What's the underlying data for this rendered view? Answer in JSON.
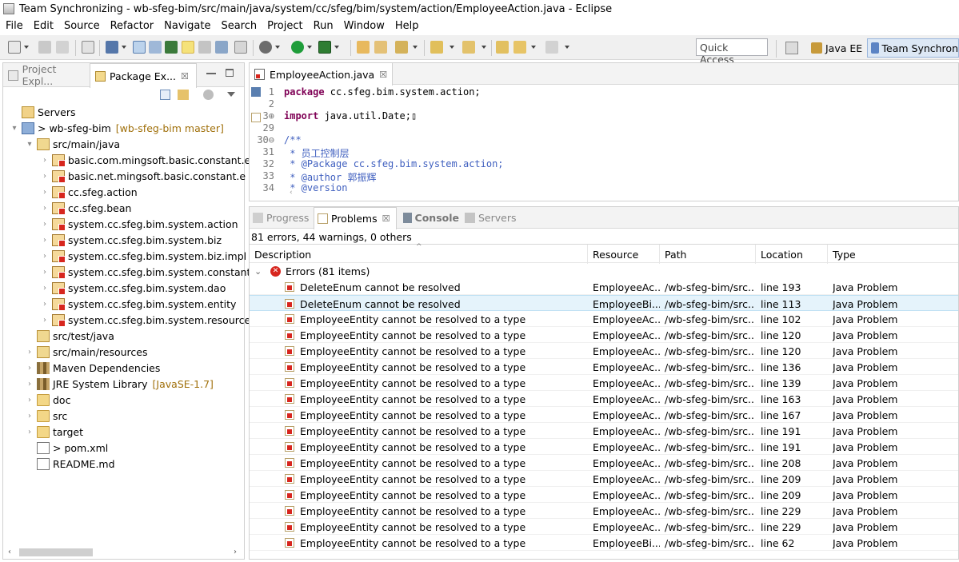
{
  "window": {
    "title": "Team Synchronizing - wb-sfeg-bim/src/main/java/system/cc/sfeg/bim/system/action/EmployeeAction.java - Eclipse"
  },
  "menu": [
    "File",
    "Edit",
    "Source",
    "Refactor",
    "Navigate",
    "Search",
    "Project",
    "Run",
    "Window",
    "Help"
  ],
  "toolbar": {
    "quick_access_placeholder": "Quick Access",
    "perspectives": [
      {
        "label": "Java EE",
        "icon": "java-ee-perspective-icon"
      },
      {
        "label": "Team Synchron",
        "icon": "team-sync-perspective-icon"
      }
    ]
  },
  "explorer": {
    "tabs": [
      {
        "label": "Project Expl...",
        "active": false
      },
      {
        "label": "Package Ex...",
        "active": true
      }
    ],
    "close_glyph": "☒",
    "items": [
      {
        "label": "Servers",
        "depth": 0,
        "expander": "",
        "icon": "servers"
      },
      {
        "label": "> wb-sfeg-bim",
        "decor": "[wb-sfeg-bim master]",
        "depth": 0,
        "expander": "▾",
        "icon": "proj"
      },
      {
        "label": "src/main/java",
        "depth": 1,
        "expander": "▾",
        "icon": "srcfolder"
      },
      {
        "label": "basic.com.mingsoft.basic.constant.e",
        "depth": 2,
        "expander": "›",
        "icon": "pkg"
      },
      {
        "label": "basic.net.mingsoft.basic.constant.e",
        "depth": 2,
        "expander": "›",
        "icon": "pkg"
      },
      {
        "label": "cc.sfeg.action",
        "depth": 2,
        "expander": "›",
        "icon": "pkg"
      },
      {
        "label": "cc.sfeg.bean",
        "depth": 2,
        "expander": "›",
        "icon": "pkg"
      },
      {
        "label": "system.cc.sfeg.bim.system.action",
        "depth": 2,
        "expander": "›",
        "icon": "pkg"
      },
      {
        "label": "system.cc.sfeg.bim.system.biz",
        "depth": 2,
        "expander": "›",
        "icon": "pkg"
      },
      {
        "label": "system.cc.sfeg.bim.system.biz.impl",
        "depth": 2,
        "expander": "›",
        "icon": "pkg"
      },
      {
        "label": "system.cc.sfeg.bim.system.constant.e",
        "depth": 2,
        "expander": "›",
        "icon": "pkg"
      },
      {
        "label": "system.cc.sfeg.bim.system.dao",
        "depth": 2,
        "expander": "›",
        "icon": "pkg"
      },
      {
        "label": "system.cc.sfeg.bim.system.entity",
        "depth": 2,
        "expander": "›",
        "icon": "pkg"
      },
      {
        "label": "system.cc.sfeg.bim.system.resources",
        "depth": 2,
        "expander": "›",
        "icon": "pkg"
      },
      {
        "label": "src/test/java",
        "depth": 1,
        "expander": "",
        "icon": "srcfolder"
      },
      {
        "label": "src/main/resources",
        "depth": 1,
        "expander": "›",
        "icon": "srcfolder"
      },
      {
        "label": "Maven Dependencies",
        "depth": 1,
        "expander": "›",
        "icon": "libr"
      },
      {
        "label": "JRE System Library",
        "decor": "[JavaSE-1.7]",
        "depth": 1,
        "expander": "›",
        "icon": "libr"
      },
      {
        "label": "doc",
        "depth": 1,
        "expander": "›",
        "icon": "folder"
      },
      {
        "label": "src",
        "depth": 1,
        "expander": "›",
        "icon": "folder"
      },
      {
        "label": "target",
        "depth": 1,
        "expander": "›",
        "icon": "folder"
      },
      {
        "label": "> pom.xml",
        "depth": 1,
        "expander": "",
        "icon": "file"
      },
      {
        "label": "README.md",
        "depth": 1,
        "expander": "",
        "icon": "file"
      }
    ]
  },
  "editor": {
    "tab_label": "EmployeeAction.java",
    "close_glyph": "☒",
    "lines": [
      {
        "num": "1",
        "parts": [
          {
            "t": "package ",
            "c": "kw"
          },
          {
            "t": "cc.sfeg.bim.system.action;",
            "c": ""
          }
        ]
      },
      {
        "num": "2",
        "parts": []
      },
      {
        "num": "3⊕",
        "parts": [
          {
            "t": "import ",
            "c": "kw"
          },
          {
            "t": "java.util.Date;▯",
            "c": ""
          }
        ]
      },
      {
        "num": "29",
        "parts": []
      },
      {
        "num": "30⊖",
        "parts": [
          {
            "t": "/**",
            "c": "cm"
          }
        ]
      },
      {
        "num": "31",
        "parts": [
          {
            "t": " * 员工控制层",
            "c": "cm"
          }
        ]
      },
      {
        "num": "32",
        "parts": [
          {
            "t": " * @Package cc.sfeg.bim.system.action;",
            "c": "cm"
          }
        ]
      },
      {
        "num": "33",
        "parts": [
          {
            "t": " * @author 郭振辉",
            "c": "cm"
          }
        ]
      },
      {
        "num": "34",
        "parts": [
          {
            "t": " * @version",
            "c": "cm"
          }
        ]
      }
    ]
  },
  "problems_view": {
    "tabs": [
      {
        "label": "Progress",
        "active": false,
        "icon": "progress-icon"
      },
      {
        "label": "Problems",
        "active": true,
        "icon": "problems-icon"
      },
      {
        "label": "Console",
        "active": false,
        "icon": "console-icon"
      },
      {
        "label": "Servers",
        "active": false,
        "icon": "servers-tab-icon"
      }
    ],
    "close_glyph": "☒",
    "summary": "81 errors, 44 warnings, 0 others",
    "columns": [
      "Description",
      "Resource",
      "Path",
      "Location",
      "Type"
    ],
    "group": {
      "label": "Errors (81 items)",
      "toggle": "⌄"
    },
    "rows": [
      {
        "desc": "DeleteEnum cannot be resolved",
        "res": "EmployeeAc...",
        "path": "/wb-sfeg-bim/src...",
        "loc": "line 193",
        "type": "Java Problem"
      },
      {
        "desc": "DeleteEnum cannot be resolved",
        "res": "EmployeeBi...",
        "path": "/wb-sfeg-bim/src...",
        "loc": "line 113",
        "type": "Java Problem"
      },
      {
        "desc": "EmployeeEntity cannot be resolved to a type",
        "res": "EmployeeAc...",
        "path": "/wb-sfeg-bim/src...",
        "loc": "line 102",
        "type": "Java Problem"
      },
      {
        "desc": "EmployeeEntity cannot be resolved to a type",
        "res": "EmployeeAc...",
        "path": "/wb-sfeg-bim/src...",
        "loc": "line 120",
        "type": "Java Problem"
      },
      {
        "desc": "EmployeeEntity cannot be resolved to a type",
        "res": "EmployeeAc...",
        "path": "/wb-sfeg-bim/src...",
        "loc": "line 120",
        "type": "Java Problem"
      },
      {
        "desc": "EmployeeEntity cannot be resolved to a type",
        "res": "EmployeeAc...",
        "path": "/wb-sfeg-bim/src...",
        "loc": "line 136",
        "type": "Java Problem"
      },
      {
        "desc": "EmployeeEntity cannot be resolved to a type",
        "res": "EmployeeAc...",
        "path": "/wb-sfeg-bim/src...",
        "loc": "line 139",
        "type": "Java Problem"
      },
      {
        "desc": "EmployeeEntity cannot be resolved to a type",
        "res": "EmployeeAc...",
        "path": "/wb-sfeg-bim/src...",
        "loc": "line 163",
        "type": "Java Problem"
      },
      {
        "desc": "EmployeeEntity cannot be resolved to a type",
        "res": "EmployeeAc...",
        "path": "/wb-sfeg-bim/src...",
        "loc": "line 167",
        "type": "Java Problem"
      },
      {
        "desc": "EmployeeEntity cannot be resolved to a type",
        "res": "EmployeeAc...",
        "path": "/wb-sfeg-bim/src...",
        "loc": "line 191",
        "type": "Java Problem"
      },
      {
        "desc": "EmployeeEntity cannot be resolved to a type",
        "res": "EmployeeAc...",
        "path": "/wb-sfeg-bim/src...",
        "loc": "line 191",
        "type": "Java Problem"
      },
      {
        "desc": "EmployeeEntity cannot be resolved to a type",
        "res": "EmployeeAc...",
        "path": "/wb-sfeg-bim/src...",
        "loc": "line 208",
        "type": "Java Problem"
      },
      {
        "desc": "EmployeeEntity cannot be resolved to a type",
        "res": "EmployeeAc...",
        "path": "/wb-sfeg-bim/src...",
        "loc": "line 209",
        "type": "Java Problem"
      },
      {
        "desc": "EmployeeEntity cannot be resolved to a type",
        "res": "EmployeeAc...",
        "path": "/wb-sfeg-bim/src...",
        "loc": "line 209",
        "type": "Java Problem"
      },
      {
        "desc": "EmployeeEntity cannot be resolved to a type",
        "res": "EmployeeAc...",
        "path": "/wb-sfeg-bim/src...",
        "loc": "line 229",
        "type": "Java Problem"
      },
      {
        "desc": "EmployeeEntity cannot be resolved to a type",
        "res": "EmployeeAc...",
        "path": "/wb-sfeg-bim/src...",
        "loc": "line 229",
        "type": "Java Problem"
      },
      {
        "desc": "EmployeeEntity cannot be resolved to a type",
        "res": "EmployeeBi...",
        "path": "/wb-sfeg-bim/src...",
        "loc": "line 62",
        "type": "Java Problem"
      }
    ],
    "selected_row": 1
  },
  "colors": {
    "keyword": "#7f0055",
    "comment": "#3f5fbf",
    "selection": "#e5f3fb",
    "error": "#d7261e"
  }
}
